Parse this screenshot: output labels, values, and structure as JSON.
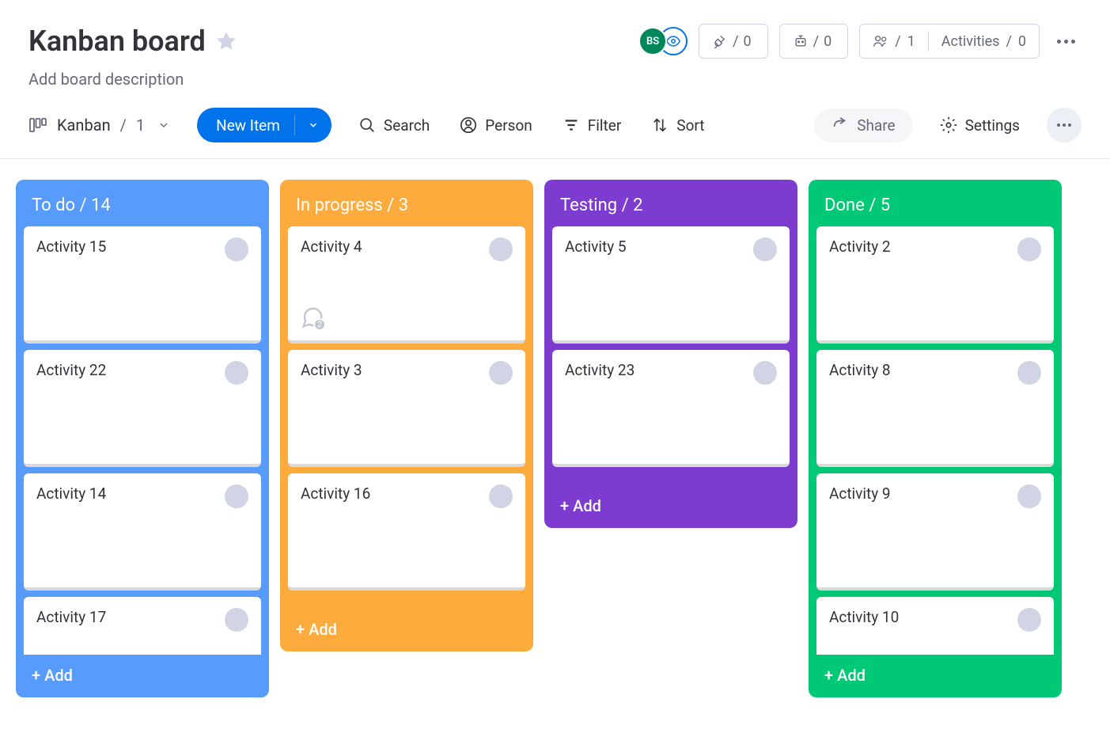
{
  "header": {
    "title": "Kanban board",
    "description": "Add board description",
    "avatar_initials": "BS",
    "plug_count": "0",
    "robot_count": "0",
    "people_count": "1",
    "activities_label": "Activities",
    "activities_count": "0"
  },
  "toolbar": {
    "view_name": "Kanban",
    "view_count": "1",
    "new_item": "New Item",
    "search": "Search",
    "person": "Person",
    "filter": "Filter",
    "sort": "Sort",
    "share": "Share",
    "settings": "Settings"
  },
  "columns": {
    "todo": {
      "header": "To do / 14",
      "add": "+ Add"
    },
    "inprogress": {
      "header": "In progress / 3",
      "add": "+ Add"
    },
    "testing": {
      "header": "Testing / 2",
      "add": "+ Add"
    },
    "done": {
      "header": "Done / 5",
      "add": "+ Add"
    }
  },
  "cards": {
    "todo": [
      {
        "title": "Activity 15"
      },
      {
        "title": "Activity 22"
      },
      {
        "title": "Activity 14"
      },
      {
        "title": "Activity 17"
      }
    ],
    "inprogress": [
      {
        "title": "Activity 4",
        "comments": "2"
      },
      {
        "title": "Activity 3"
      },
      {
        "title": "Activity 16"
      }
    ],
    "testing": [
      {
        "title": "Activity 5"
      },
      {
        "title": "Activity 23"
      }
    ],
    "done": [
      {
        "title": "Activity 2"
      },
      {
        "title": "Activity 8"
      },
      {
        "title": "Activity 9"
      },
      {
        "title": "Activity 10"
      }
    ]
  }
}
